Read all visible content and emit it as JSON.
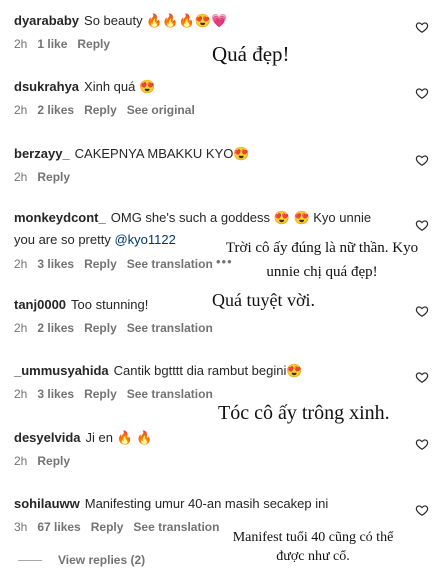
{
  "comments": [
    {
      "user": "dyarababy",
      "text": "So beauty 🔥🔥🔥😍💗",
      "time": "2h",
      "likes": "1 like",
      "reply": "Reply"
    },
    {
      "user": "dsukrahya",
      "text": "Xinh quá 😍",
      "time": "2h",
      "likes": "2 likes",
      "reply": "Reply",
      "extra": "See original"
    },
    {
      "user": "berzayy_",
      "text": "CAKEPNYA MBAKKU KYO😍",
      "time": "2h",
      "reply": "Reply"
    },
    {
      "user": "monkeydcont_",
      "text": "OMG she's such a goddess 😍 😍 Kyo unnie you are so pretty ",
      "mention": "@kyo1122",
      "time": "2h",
      "likes": "3 likes",
      "reply": "Reply",
      "extra": "See translation"
    },
    {
      "user": "tanj0000",
      "text": "Too stunning!",
      "time": "2h",
      "likes": "2 likes",
      "reply": "Reply",
      "extra": "See translation"
    },
    {
      "user": "_ummusyahida",
      "text": "Cantik bgtttt dia rambut begini😍",
      "time": "2h",
      "likes": "3 likes",
      "reply": "Reply",
      "extra": "See translation"
    },
    {
      "user": "desyelvida",
      "text": "Ji en 🔥 🔥",
      "time": "2h",
      "reply": "Reply"
    },
    {
      "user": "sohilauww",
      "text": "Manifesting umur 40-an masih secakep ini",
      "time": "3h",
      "likes": "67 likes",
      "reply": "Reply",
      "extra": "See translation"
    }
  ],
  "overlays": {
    "t1": "Quá đẹp!",
    "t2a": "Trời cô ấy đúng là nữ thần. Kyo",
    "t2b": "unnie chị quá đẹp!",
    "t3": "Quá tuyệt vời.",
    "t4": "Tóc cô ấy trông xinh.",
    "t5a": "Manifest tuổi 40 cũng có thể",
    "t5b": "được như cổ."
  },
  "more_dots": "•••",
  "view_replies": "View replies (2)",
  "colors": {
    "text": "#262626",
    "meta": "#737373",
    "mention": "#00376b"
  }
}
